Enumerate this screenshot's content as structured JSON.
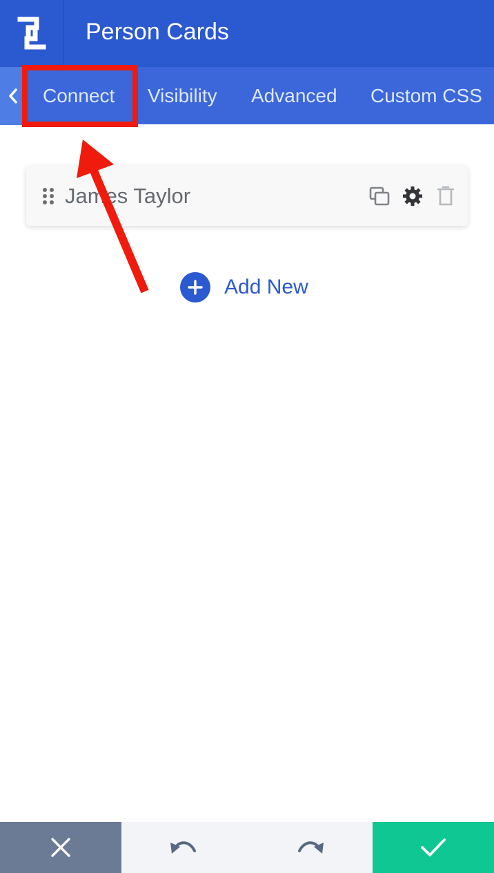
{
  "header": {
    "title": "Person Cards",
    "logo_icon": "builder-logo-icon",
    "background_color": "#2b59cf"
  },
  "tabs": {
    "back_icon": "chevron-left-icon",
    "items": [
      {
        "label": "Connect",
        "highlighted": true
      },
      {
        "label": "Visibility"
      },
      {
        "label": "Advanced"
      },
      {
        "label": "Custom CSS"
      }
    ],
    "background_color": "#3b67db"
  },
  "items": [
    {
      "title": "James Taylor",
      "actions": [
        "duplicate-icon",
        "gear-icon",
        "trash-icon"
      ]
    }
  ],
  "add_new": {
    "label": "Add New",
    "icon": "plus-circle-icon"
  },
  "bottom_bar": {
    "cancel_icon": "close-icon",
    "undo_icon": "undo-icon",
    "redo_icon": "redo-icon",
    "save_icon": "check-icon",
    "cancel_color": "#6b7b96",
    "save_color": "#0ec793"
  },
  "annotation": {
    "color": "#f01b0c",
    "target": "Connect"
  }
}
